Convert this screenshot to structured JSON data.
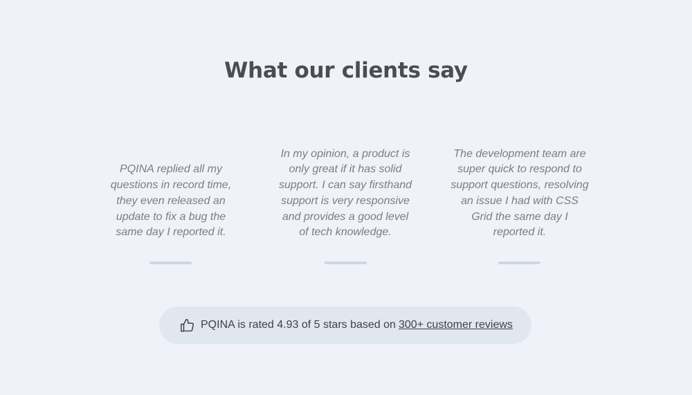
{
  "heading": "What our clients say",
  "testimonials": [
    {
      "quote": "PQINA replied all my questions in record time, they even released an update to fix a bug the same day I reported it."
    },
    {
      "quote": "In my opinion, a product is only great if it has solid support. I can say firsthand support is very responsive and provides a good level of tech knowledge."
    },
    {
      "quote": "The development team are super quick to respond to support questions, resolving an issue I had with CSS Grid the same day I reported it."
    }
  ],
  "rating": {
    "icon": "thumbs-up-icon",
    "text": "PQINA is rated 4.93 of 5 stars based on",
    "link_label": "300+ customer reviews"
  },
  "colors": {
    "background": "#eff3f9",
    "pill": "#e1e7ef",
    "divider": "#cfd6df"
  }
}
